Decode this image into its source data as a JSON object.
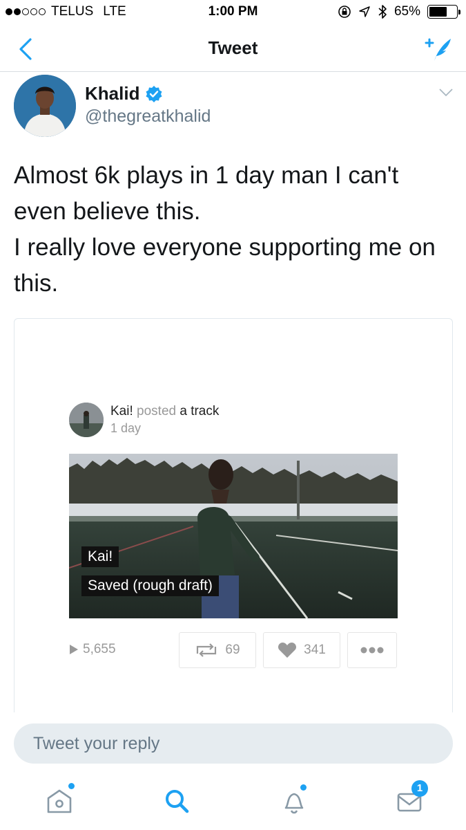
{
  "status_bar": {
    "carrier": "TELUS",
    "network": "LTE",
    "time": "1:00 PM",
    "battery": "65%",
    "battery_level": 0.65,
    "signal_bars_filled": 2,
    "signal_bars_total": 5
  },
  "nav": {
    "title": "Tweet",
    "back_icon": "chevron-left-icon",
    "compose_icon": "compose-tweet-icon"
  },
  "tweet": {
    "author_name": "Khalid",
    "author_handle": "@thegreatkhalid",
    "verified": true,
    "text_lines": [
      "Almost 6k plays in 1 day man I can't",
      "even believe this.",
      "I really love everyone supporting me on",
      "this."
    ]
  },
  "embed": {
    "poster": "Kai!",
    "action_word": "posted",
    "action_object": "a track",
    "age": "1 day",
    "artist": "Kai!",
    "track_title": "Saved (rough draft)",
    "plays": "5,655",
    "reposts": "69",
    "likes": "341"
  },
  "reply": {
    "placeholder": "Tweet your reply"
  },
  "tabbar": {
    "messages_badge": "1"
  },
  "colors": {
    "accent": "#1da1f2",
    "verified": "#1da1f2",
    "muted": "#657786",
    "reply_bg": "#e6ecf0"
  }
}
